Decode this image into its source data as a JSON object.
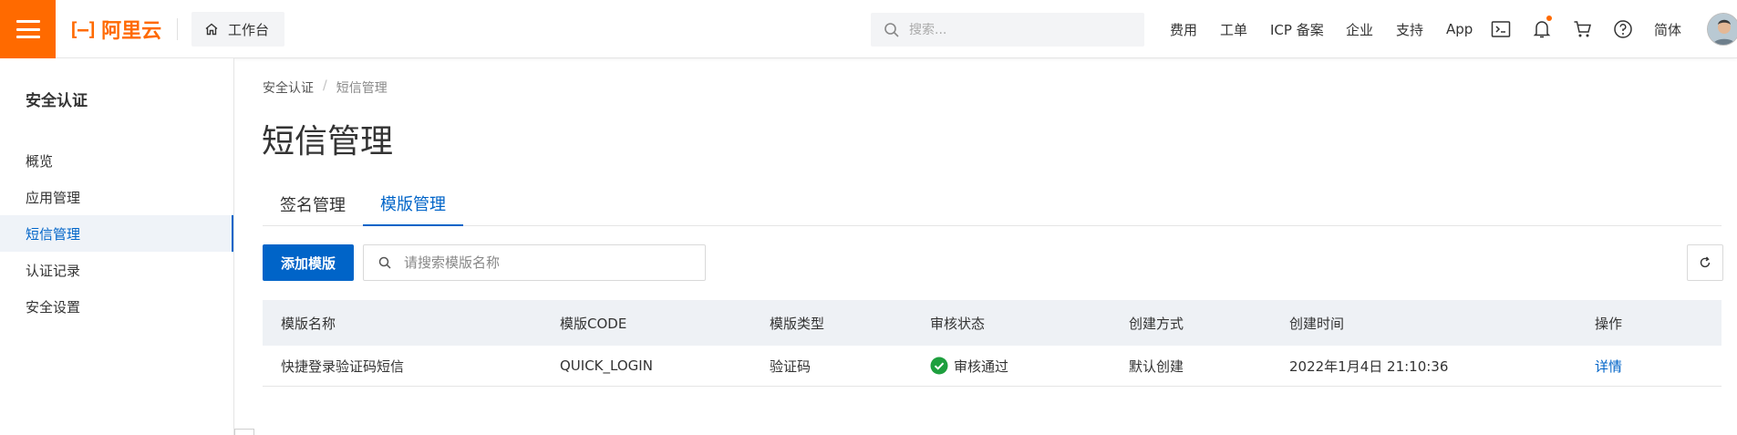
{
  "topbar": {
    "brand": "阿里云",
    "workbench_label": "工作台",
    "search_placeholder": "搜索...",
    "nav_fees": "费用",
    "nav_tickets": "工单",
    "nav_icp": "ICP 备案",
    "nav_enterprise": "企业",
    "nav_support": "支持",
    "nav_app": "App",
    "nav_lang": "简体",
    "accent_color": "#ff6a00"
  },
  "sidebar": {
    "title": "安全认证",
    "items": [
      {
        "label": "概览"
      },
      {
        "label": "应用管理"
      },
      {
        "label": "短信管理"
      },
      {
        "label": "认证记录"
      },
      {
        "label": "安全设置"
      }
    ]
  },
  "breadcrumb": {
    "root": "安全认证",
    "separator": "/",
    "current": "短信管理"
  },
  "page": {
    "title": "短信管理"
  },
  "tabs": [
    {
      "label": "签名管理"
    },
    {
      "label": "模版管理"
    }
  ],
  "toolbar": {
    "add_label": "添加模版",
    "search_placeholder": "请搜索模版名称"
  },
  "table": {
    "columns": [
      "模版名称",
      "模版CODE",
      "模版类型",
      "审核状态",
      "创建方式",
      "创建时间",
      "操作"
    ],
    "rows": [
      {
        "name": "快捷登录验证码短信",
        "code": "QUICK_LOGIN",
        "type": "验证码",
        "status": "审核通过",
        "method": "默认创建",
        "created": "2022年1月4日 21:10:36",
        "action": "详情"
      }
    ]
  },
  "colors": {
    "primary": "#0064c8",
    "success": "#1e9f3e"
  }
}
